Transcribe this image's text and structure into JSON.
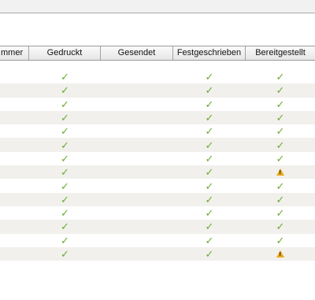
{
  "columns": {
    "nummer": "mmer",
    "gedruckt": "Gedruckt",
    "gesendet": "Gesendet",
    "festgeschrieben": "Festgeschrieben",
    "bereitgestellt": "Bereitgestellt"
  },
  "symbols": {
    "check": "✓"
  },
  "status_icons": {
    "ok": "check-icon",
    "warning": "warning-icon"
  },
  "colors": {
    "check": "#6cab2f",
    "warning": "#e7a81c",
    "row_alt": "#f1f0ec"
  },
  "rows": [
    {
      "gedruckt": "ok",
      "gesendet": "",
      "festgeschrieben": "ok",
      "bereitgestellt": "ok"
    },
    {
      "gedruckt": "ok",
      "gesendet": "",
      "festgeschrieben": "ok",
      "bereitgestellt": "ok"
    },
    {
      "gedruckt": "ok",
      "gesendet": "",
      "festgeschrieben": "ok",
      "bereitgestellt": "ok"
    },
    {
      "gedruckt": "ok",
      "gesendet": "",
      "festgeschrieben": "ok",
      "bereitgestellt": "ok"
    },
    {
      "gedruckt": "ok",
      "gesendet": "",
      "festgeschrieben": "ok",
      "bereitgestellt": "ok"
    },
    {
      "gedruckt": "ok",
      "gesendet": "",
      "festgeschrieben": "ok",
      "bereitgestellt": "ok"
    },
    {
      "gedruckt": "ok",
      "gesendet": "",
      "festgeschrieben": "ok",
      "bereitgestellt": "ok"
    },
    {
      "gedruckt": "ok",
      "gesendet": "",
      "festgeschrieben": "ok",
      "bereitgestellt": "warning"
    },
    {
      "gedruckt": "ok",
      "gesendet": "",
      "festgeschrieben": "ok",
      "bereitgestellt": "ok"
    },
    {
      "gedruckt": "ok",
      "gesendet": "",
      "festgeschrieben": "ok",
      "bereitgestellt": "ok"
    },
    {
      "gedruckt": "ok",
      "gesendet": "",
      "festgeschrieben": "ok",
      "bereitgestellt": "ok"
    },
    {
      "gedruckt": "ok",
      "gesendet": "",
      "festgeschrieben": "ok",
      "bereitgestellt": "ok"
    },
    {
      "gedruckt": "ok",
      "gesendet": "",
      "festgeschrieben": "ok",
      "bereitgestellt": "ok"
    },
    {
      "gedruckt": "ok",
      "gesendet": "",
      "festgeschrieben": "ok",
      "bereitgestellt": "warning"
    }
  ]
}
